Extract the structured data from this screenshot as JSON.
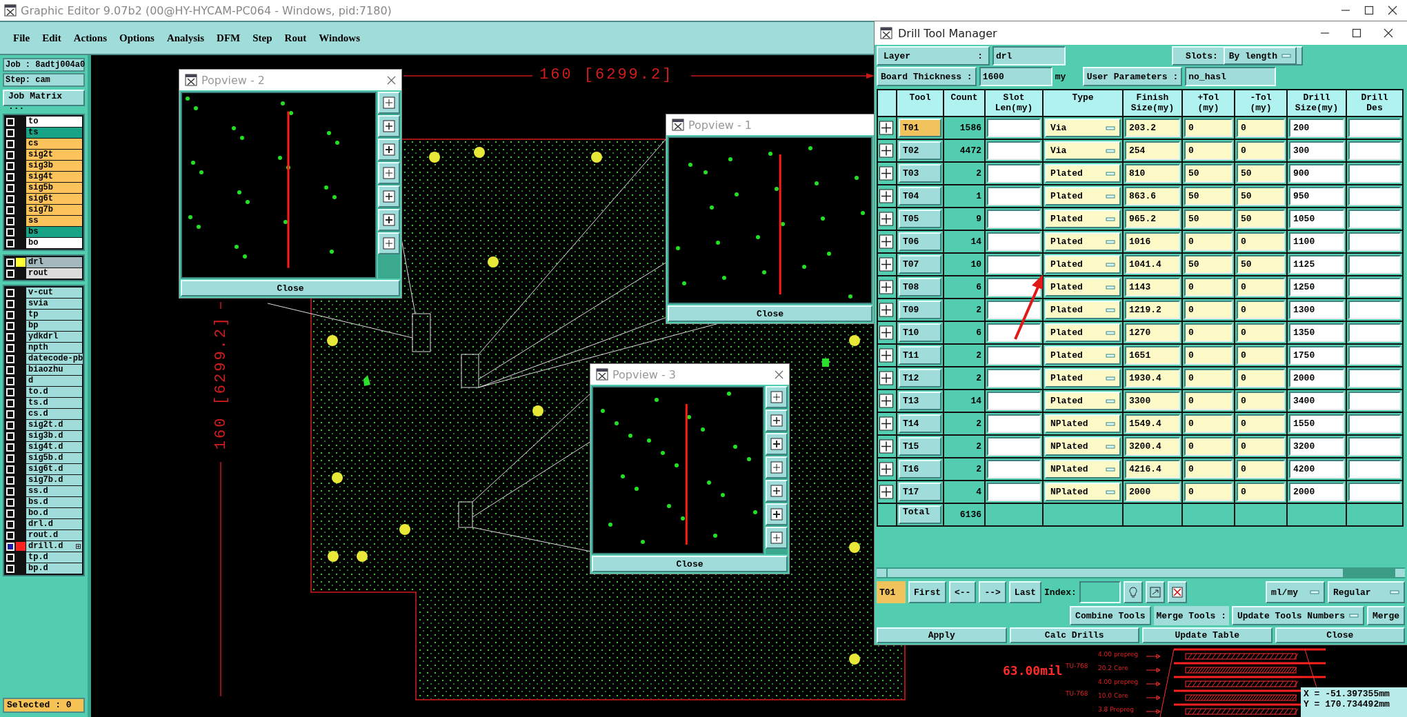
{
  "window": {
    "title": "Graphic Editor 9.07b2 (00@HY-HYCAM-PC064 - Windows, pid:7180)"
  },
  "menu": [
    "File",
    "Edit",
    "Actions",
    "Options",
    "Analysis",
    "DFM",
    "Step",
    "Rout",
    "Windows"
  ],
  "job_panel": {
    "job": "Job : 8adtj004a0",
    "step": "Step: cam",
    "matrix_button": "Job Matrix ...",
    "layer_groups": [
      [
        {
          "name": "to",
          "kind": "silk",
          "affected": false,
          "marked": false
        },
        {
          "name": "ts",
          "kind": "mask",
          "affected": false,
          "marked": false
        },
        {
          "name": "cs",
          "kind": "signal",
          "affected": false,
          "marked": false
        },
        {
          "name": "sig2t",
          "kind": "signal",
          "affected": false,
          "marked": false
        },
        {
          "name": "sig3b",
          "kind": "signal",
          "affected": false,
          "marked": false
        },
        {
          "name": "sig4t",
          "kind": "signal",
          "affected": false,
          "marked": false
        },
        {
          "name": "sig5b",
          "kind": "signal",
          "affected": false,
          "marked": false
        },
        {
          "name": "sig6t",
          "kind": "signal",
          "affected": false,
          "marked": false
        },
        {
          "name": "sig7b",
          "kind": "signal",
          "affected": false,
          "marked": false
        },
        {
          "name": "ss",
          "kind": "signal",
          "affected": false,
          "marked": false
        },
        {
          "name": "bs",
          "kind": "mask",
          "affected": false,
          "marked": false
        },
        {
          "name": "bo",
          "kind": "silk",
          "affected": false,
          "marked": false
        }
      ],
      [
        {
          "name": "drl",
          "kind": "drill",
          "color": "#ffff33",
          "affected": false,
          "marked": false
        },
        {
          "name": "rout",
          "kind": "rout",
          "affected": false,
          "marked": false
        }
      ],
      [
        {
          "name": "v-cut",
          "kind": "misc",
          "affected": false,
          "marked": false
        },
        {
          "name": "svia",
          "kind": "misc",
          "affected": false,
          "marked": false
        },
        {
          "name": "tp",
          "kind": "misc",
          "affected": false,
          "marked": false
        },
        {
          "name": "bp",
          "kind": "misc",
          "affected": false,
          "marked": false
        },
        {
          "name": "ydkdrl",
          "kind": "misc",
          "affected": false,
          "marked": false
        },
        {
          "name": "npth",
          "kind": "misc",
          "affected": false,
          "marked": false
        },
        {
          "name": "datecode-pb",
          "kind": "misc",
          "affected": false,
          "marked": false
        },
        {
          "name": "biaozhu",
          "kind": "misc",
          "affected": false,
          "marked": false
        },
        {
          "name": "d",
          "kind": "misc",
          "affected": false,
          "marked": false
        },
        {
          "name": "to.d",
          "kind": "misc",
          "affected": false,
          "marked": false
        },
        {
          "name": "ts.d",
          "kind": "misc",
          "affected": false,
          "marked": false
        },
        {
          "name": "cs.d",
          "kind": "misc",
          "affected": false,
          "marked": false
        },
        {
          "name": "sig2t.d",
          "kind": "misc",
          "affected": false,
          "marked": false
        },
        {
          "name": "sig3b.d",
          "kind": "misc",
          "affected": false,
          "marked": false
        },
        {
          "name": "sig4t.d",
          "kind": "misc",
          "affected": false,
          "marked": false
        },
        {
          "name": "sig5b.d",
          "kind": "misc",
          "affected": false,
          "marked": false
        },
        {
          "name": "sig6t.d",
          "kind": "misc",
          "affected": false,
          "marked": false
        },
        {
          "name": "sig7b.d",
          "kind": "misc",
          "affected": false,
          "marked": false
        },
        {
          "name": "ss.d",
          "kind": "misc",
          "affected": false,
          "marked": false
        },
        {
          "name": "bs.d",
          "kind": "misc",
          "affected": false,
          "marked": false
        },
        {
          "name": "bo.d",
          "kind": "misc",
          "affected": false,
          "marked": false
        },
        {
          "name": "drl.d",
          "kind": "misc",
          "affected": false,
          "marked": false
        },
        {
          "name": "rout.d",
          "kind": "misc",
          "affected": false,
          "marked": false
        },
        {
          "name": "drill.d",
          "kind": "misc",
          "color": "#ff2020",
          "affected": true,
          "marked": true
        },
        {
          "name": "tp.d",
          "kind": "misc",
          "affected": false,
          "marked": false
        },
        {
          "name": "bp.d",
          "kind": "misc",
          "affected": false,
          "marked": false
        }
      ]
    ],
    "status": "Selected : 0"
  },
  "canvas": {
    "dimension_labels": [
      "160 [6299.2]",
      "160 [6299.2]"
    ],
    "stackup": {
      "thickness": "63.00mil",
      "layers": [
        {
          "label": "4.00 prepreg",
          "kind": "prepreg"
        },
        {
          "label": "20.2 Core",
          "kind": "core",
          "material": "TU-768"
        },
        {
          "label": "4.00 prepreg",
          "kind": "prepreg"
        },
        {
          "label": "10.0  Core",
          "kind": "core",
          "material": "TU-768"
        },
        {
          "label": "3.8 Prepreg",
          "kind": "prepreg"
        }
      ]
    },
    "cursor": {
      "x": "X = -51.397355mm",
      "y": "Y = 170.734492mm"
    }
  },
  "popviews": [
    {
      "title": "Popview - 2",
      "button": "Close",
      "toolbar": true,
      "close_icon": true
    },
    {
      "title": "Popview - 1",
      "button": "Close",
      "toolbar": false,
      "close_icon": false
    },
    {
      "title": "Popview - 3",
      "button": "Close",
      "toolbar": true,
      "close_icon": true
    }
  ],
  "drill_tool_manager": {
    "title": "Drill Tool Manager",
    "layer_label": "Layer",
    "layer_colon": ":",
    "layer": "drl",
    "slots_label": "Slots:",
    "slots": "By length",
    "thickness_label": "Board Thickness :",
    "thickness": "1600",
    "thickness_unit": "my",
    "user_params_label": "User Parameters :",
    "user_params": "no_hasl",
    "columns": [
      "Tool",
      "Count",
      "Slot\nLen(my)",
      "Type",
      "Finish\nSize(my)",
      "+Tol\n(my)",
      "-Tol\n(my)",
      "Drill\nSize(my)",
      "Drill\nDes"
    ],
    "rows": [
      {
        "tool": "T01",
        "count": "1586",
        "type": "Via",
        "finish": "203.2",
        "plus_tol": "0",
        "minus_tol": "0",
        "drill_size": "200",
        "selected": true
      },
      {
        "tool": "T02",
        "count": "4472",
        "type": "Via",
        "finish": "254",
        "plus_tol": "0",
        "minus_tol": "0",
        "drill_size": "300",
        "selected": false
      },
      {
        "tool": "T03",
        "count": "2",
        "type": "Plated",
        "finish": "810",
        "plus_tol": "50",
        "minus_tol": "50",
        "drill_size": "900",
        "selected": false
      },
      {
        "tool": "T04",
        "count": "1",
        "type": "Plated",
        "finish": "863.6",
        "plus_tol": "50",
        "minus_tol": "50",
        "drill_size": "950",
        "selected": false
      },
      {
        "tool": "T05",
        "count": "9",
        "type": "Plated",
        "finish": "965.2",
        "plus_tol": "50",
        "minus_tol": "50",
        "drill_size": "1050",
        "selected": false
      },
      {
        "tool": "T06",
        "count": "14",
        "type": "Plated",
        "finish": "1016",
        "plus_tol": "0",
        "minus_tol": "0",
        "drill_size": "1100",
        "selected": false
      },
      {
        "tool": "T07",
        "count": "10",
        "type": "Plated",
        "finish": "1041.4",
        "plus_tol": "50",
        "minus_tol": "50",
        "drill_size": "1125",
        "selected": false
      },
      {
        "tool": "T08",
        "count": "6",
        "type": "Plated",
        "finish": "1143",
        "plus_tol": "0",
        "minus_tol": "0",
        "drill_size": "1250",
        "selected": false
      },
      {
        "tool": "T09",
        "count": "2",
        "type": "Plated",
        "finish": "1219.2",
        "plus_tol": "0",
        "minus_tol": "0",
        "drill_size": "1300",
        "selected": false
      },
      {
        "tool": "T10",
        "count": "6",
        "type": "Plated",
        "finish": "1270",
        "plus_tol": "0",
        "minus_tol": "0",
        "drill_size": "1350",
        "selected": false
      },
      {
        "tool": "T11",
        "count": "2",
        "type": "Plated",
        "finish": "1651",
        "plus_tol": "0",
        "minus_tol": "0",
        "drill_size": "1750",
        "selected": false
      },
      {
        "tool": "T12",
        "count": "2",
        "type": "Plated",
        "finish": "1930.4",
        "plus_tol": "0",
        "minus_tol": "0",
        "drill_size": "2000",
        "selected": false
      },
      {
        "tool": "T13",
        "count": "14",
        "type": "Plated",
        "finish": "3300",
        "plus_tol": "0",
        "minus_tol": "0",
        "drill_size": "3400",
        "selected": false
      },
      {
        "tool": "T14",
        "count": "2",
        "type": "NPlated",
        "finish": "1549.4",
        "plus_tol": "0",
        "minus_tol": "0",
        "drill_size": "1550",
        "selected": false
      },
      {
        "tool": "T15",
        "count": "2",
        "type": "NPlated",
        "finish": "3200.4",
        "plus_tol": "0",
        "minus_tol": "0",
        "drill_size": "3200",
        "selected": false
      },
      {
        "tool": "T16",
        "count": "2",
        "type": "NPlated",
        "finish": "4216.4",
        "plus_tol": "0",
        "minus_tol": "0",
        "drill_size": "4200",
        "selected": false
      },
      {
        "tool": "T17",
        "count": "4",
        "type": "NPlated",
        "finish": "2000",
        "plus_tol": "0",
        "minus_tol": "0",
        "drill_size": "2000",
        "selected": false
      }
    ],
    "total_label": "Total",
    "total": "6136",
    "current_tool": "T01",
    "nav_buttons": [
      "First",
      "<--",
      "-->",
      "Last"
    ],
    "index_label": "Index:",
    "units": "ml/my",
    "mode": "Regular",
    "combine_button": "Combine Tools",
    "merge_label": "Merge Tools :",
    "merge_option": "Update Tools Numbers",
    "merge_button": "Merge",
    "actions": [
      "Apply",
      "Calc Drills",
      "Update Table",
      "Close"
    ]
  }
}
